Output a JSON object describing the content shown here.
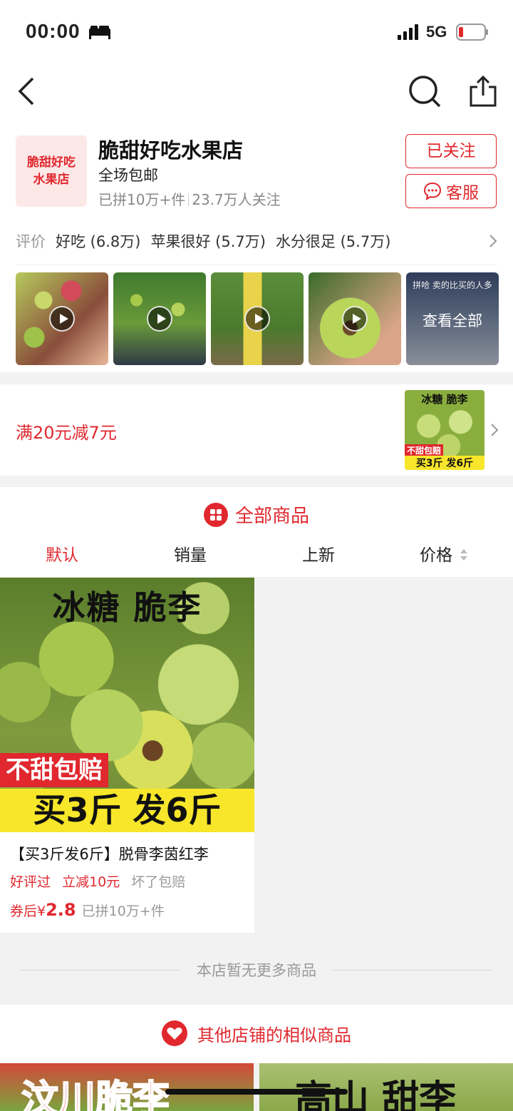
{
  "status_bar": {
    "time": "00:00",
    "network": "5G"
  },
  "shop": {
    "logo_text_line1": "脆甜好吃",
    "logo_text_line2": "水果店",
    "name": "脆甜好吃水果店",
    "subtitle": "全场包邮",
    "sold": "已拼10万+件",
    "followers": "23.7万人关注",
    "follow_button": "已关注",
    "service_button": "客服"
  },
  "reviews": {
    "label": "评价",
    "tags": [
      "好吃 (6.8万)",
      "苹果很好 (5.7万)",
      "水分很足 (5.7万)"
    ]
  },
  "videos": {
    "all_caption": "拼哈 卖的比买的人多",
    "view_all": "查看全部"
  },
  "coupon": {
    "text": "满20元减7元",
    "thumb_title": "冰糖 脆李",
    "thumb_tag1": "不甜包赔",
    "thumb_tag2": "买3斤 发6斤"
  },
  "all_products": {
    "title": "全部商品",
    "sort": [
      "默认",
      "销量",
      "上新",
      "价格"
    ],
    "active_sort": "默认"
  },
  "product": {
    "img_title": "冰糖 脆李",
    "img_tag1": "不甜包赔",
    "img_tag2": "买3斤 发6斤",
    "title": "【买3斤发6斤】脱骨李茵红李",
    "tag_good": "好评过",
    "tag_discount": "立减10元",
    "tag_guarantee": "坏了包赔",
    "price_prefix": "券后",
    "currency": "¥",
    "price": "2.8",
    "sold": "已拼10万+件"
  },
  "no_more": "本店暂无更多商品",
  "similar": {
    "title": "其他店铺的相似商品",
    "rec1_text": "汶川脆李",
    "rec2_text": "高山 甜李"
  },
  "colors": {
    "accent": "#e0282e",
    "background": "#f2f2f2"
  }
}
